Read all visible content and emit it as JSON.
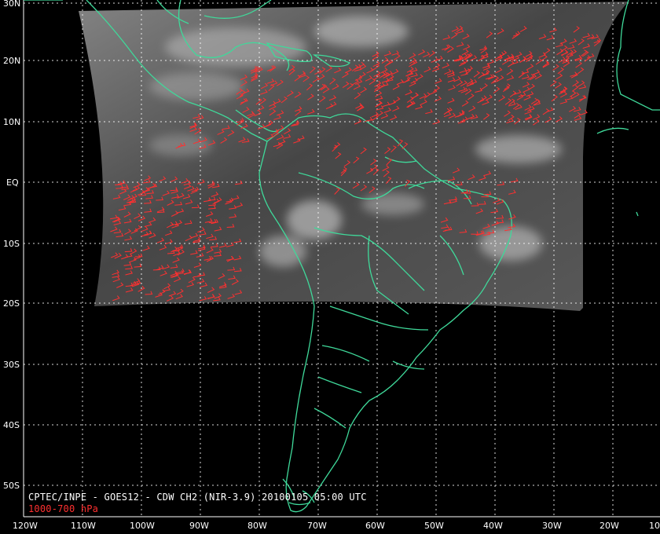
{
  "map": {
    "lat_labels": [
      "30N",
      "20N",
      "10N",
      "EQ",
      "10S",
      "20S",
      "30S",
      "40S",
      "50S"
    ],
    "lon_labels": [
      "120W",
      "110W",
      "100W",
      "90W",
      "80W",
      "70W",
      "60W",
      "50W",
      "40W",
      "30W",
      "20W",
      "10"
    ]
  },
  "caption": {
    "line1": "CPTEC/INPE - GOES12 - CDW CH2 (NIR-3.9) 20100105 05:00 UTC",
    "line2": "1000-700 hPa"
  },
  "colors": {
    "background": "#000000",
    "coastline": "#3fd99a",
    "wind_barbs": "#ff3030",
    "grid": "#ffffff",
    "satellite_swath": "#707070",
    "layer_caption": "#ff3030"
  },
  "legend_layers": [
    "satellite-swath",
    "coastlines",
    "wind-barbs",
    "lat-lon-grid"
  ]
}
